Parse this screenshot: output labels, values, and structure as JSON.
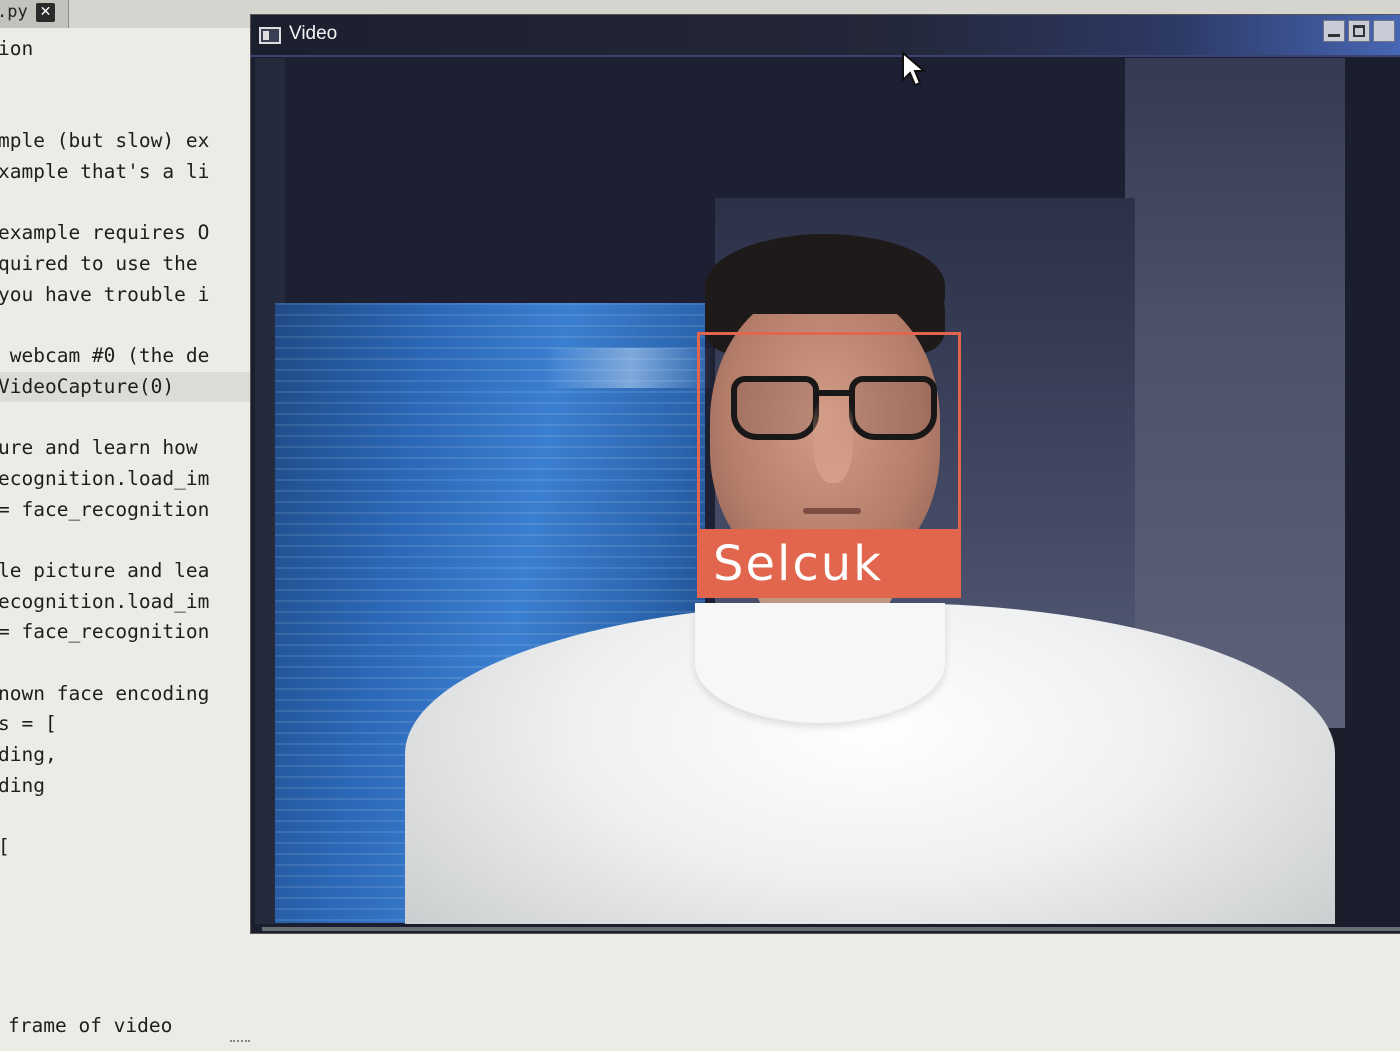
{
  "editor": {
    "tab_label": ".py",
    "tab_close_glyph": "✕",
    "lines": [
      {
        "text": "ion",
        "highlight": false
      },
      {
        "text": "",
        "highlight": false
      },
      {
        "text": "",
        "highlight": false
      },
      {
        "text": "mple (but slow) ex",
        "highlight": false
      },
      {
        "text": "xample that's a li",
        "highlight": false
      },
      {
        "text": "",
        "highlight": false
      },
      {
        "text": "example requires O",
        "highlight": false
      },
      {
        "text": "quired to use the ",
        "highlight": false
      },
      {
        "text": "you have trouble i",
        "highlight": false
      },
      {
        "text": "",
        "highlight": false
      },
      {
        "text": " webcam #0 (the de",
        "highlight": false
      },
      {
        "text": "VideoCapture(0)",
        "highlight": true
      },
      {
        "text": "",
        "highlight": false
      },
      {
        "text": "ure and learn how ",
        "highlight": false
      },
      {
        "text": "ecognition.load_im",
        "highlight": false
      },
      {
        "text": "= face_recognition",
        "highlight": false
      },
      {
        "text": "",
        "highlight": false
      },
      {
        "text": "le picture and lea",
        "highlight": false
      },
      {
        "text": "ecognition.load_im",
        "highlight": false
      },
      {
        "text": "= face_recognition",
        "highlight": false
      },
      {
        "text": "",
        "highlight": false
      },
      {
        "text": "nown face encoding",
        "highlight": false
      },
      {
        "text": "s = [",
        "highlight": false
      },
      {
        "text": "ding,",
        "highlight": false
      },
      {
        "text": "ding",
        "highlight": false
      },
      {
        "text": "",
        "highlight": false
      },
      {
        "text": "[",
        "highlight": false
      }
    ],
    "bottom_line": "frame of video"
  },
  "video_window": {
    "title": "Video",
    "icon": "window-app-icon",
    "controls": [
      "minimize",
      "maximize",
      "close"
    ]
  },
  "detection": {
    "name": "Selcuk",
    "color": "#e2664e"
  },
  "cursor": "arrow-pointer-icon"
}
